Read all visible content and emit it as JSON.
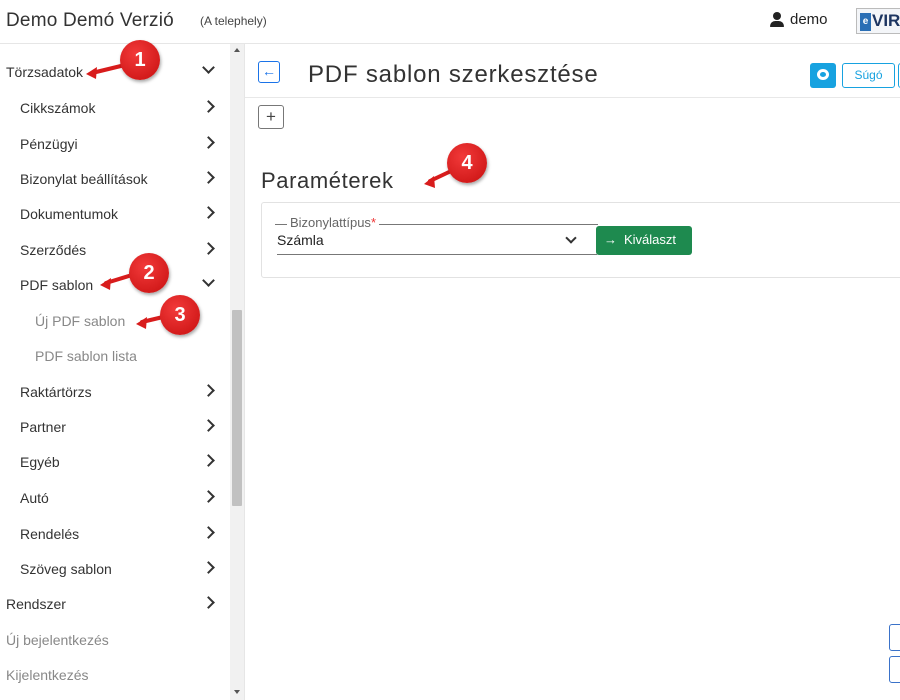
{
  "app": {
    "title": "Demo Demó Verzió",
    "subtitle": "(A telephely)",
    "user": "demo",
    "logo": "VIR",
    "logo_badge": "e"
  },
  "sidebar": {
    "items": [
      {
        "label": "Törzsadatok",
        "chevron": "down"
      },
      {
        "label": "Cikkszámok",
        "chevron": "right"
      },
      {
        "label": "Pénzügyi",
        "chevron": "right"
      },
      {
        "label": "Bizonylat beállítások",
        "chevron": "right"
      },
      {
        "label": "Dokumentumok",
        "chevron": "right"
      },
      {
        "label": "Szerződés",
        "chevron": "right"
      },
      {
        "label": "PDF sablon",
        "chevron": "down"
      },
      {
        "label": "Új PDF sablon",
        "chevron": ""
      },
      {
        "label": "PDF sablon lista",
        "chevron": ""
      },
      {
        "label": "Raktártörzs",
        "chevron": "right"
      },
      {
        "label": "Partner",
        "chevron": "right"
      },
      {
        "label": "Egyéb",
        "chevron": "right"
      },
      {
        "label": "Autó",
        "chevron": "right"
      },
      {
        "label": "Rendelés",
        "chevron": "right"
      },
      {
        "label": "Szöveg sablon",
        "chevron": "right"
      },
      {
        "label": "Rendszer",
        "chevron": "right"
      },
      {
        "label": "Új bejelentkezés",
        "chevron": ""
      },
      {
        "label": "Kijelentkezés",
        "chevron": ""
      }
    ]
  },
  "main": {
    "back_icon": "←",
    "title": "PDF sablon szerkesztése",
    "help_label": "Súgó",
    "plus_label": "+",
    "section_title": "Paraméterek",
    "field": {
      "label": "Bizonylattípus",
      "required_mark": "*",
      "value": "Számla"
    },
    "choose_arrow": "→",
    "choose_label": "Kiválaszt"
  },
  "annotations": {
    "badge_1": "1",
    "badge_2": "2",
    "badge_3": "3",
    "badge_4": "4"
  },
  "colors": {
    "accent": "#17a2e0",
    "primary": "#1a73e8",
    "success": "#1e8a4f",
    "annotation": "#d81c1c"
  }
}
